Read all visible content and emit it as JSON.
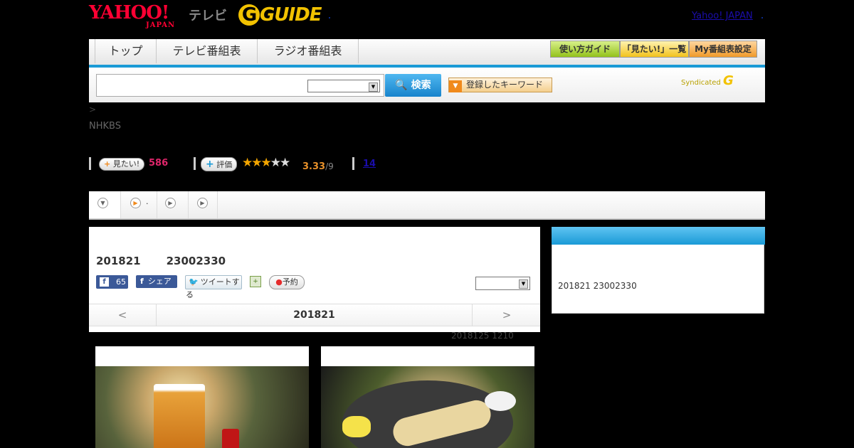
{
  "header": {
    "yahoo_logo": "YAHOO!",
    "yahoo_sub": "JAPAN",
    "tv_label": "テレビ",
    "gguide_logo": "GUIDE",
    "top_link": "Yahoo! JAPAN"
  },
  "nav": {
    "tabs": [
      "トップ",
      "テレビ番組表",
      "ラジオ番組表"
    ],
    "buttons": [
      "使い方ガイド",
      "「見たい!」一覧",
      "My番組表設定"
    ]
  },
  "search": {
    "button_label": "検索",
    "keyword_button": "登録したキーワード",
    "syndicated": "Syndicated"
  },
  "program": {
    "breadcrumb": ">",
    "channel": "NHKBS",
    "want_label": "見たい!",
    "want_count": "586",
    "rate_label": "評価",
    "rating": "3.33",
    "rating_sub": "/9",
    "review_count": "14",
    "star_fill": 3
  },
  "panel": {
    "date": "201821",
    "time": "23002330",
    "fb_count": "65",
    "share_label": "シェア",
    "tweet_label": "ツイートする",
    "reserve_label": "予約",
    "prev": "<",
    "nav_date": "201821",
    "next": ">",
    "updated": "2018125  1210"
  },
  "side": {
    "text": "201821  23002330"
  },
  "colors": {
    "accent": "#1a9ad6",
    "want_red": "#e0266b",
    "star": "#f3a500"
  }
}
